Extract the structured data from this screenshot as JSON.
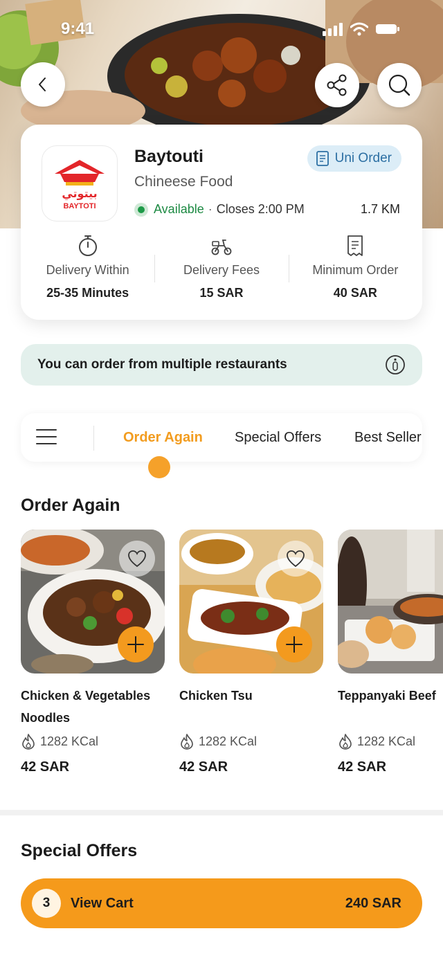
{
  "status_bar": {
    "time": "9:41"
  },
  "restaurant": {
    "name": "Baytouti",
    "cuisine": "Chineese Food",
    "logo_text_ar": "بيتوتي",
    "logo_text_en": "BAYTOTI",
    "uni_order_label": "Uni Order",
    "availability": "Available",
    "closes": "Closes 2:00 PM",
    "distance": "1.7 KM",
    "stats": [
      {
        "icon": "timer-icon",
        "label": "Delivery Within",
        "value": "25-35 Minutes"
      },
      {
        "icon": "scooter-icon",
        "label": "Delivery Fees",
        "value": "15 SAR"
      },
      {
        "icon": "receipt-icon",
        "label": "Minimum Order",
        "value": "40 SAR"
      }
    ]
  },
  "banner": {
    "text": "You can order from multiple restaurants",
    "icon": "info-icon"
  },
  "tabs": [
    {
      "label": "Order Again",
      "active": true
    },
    {
      "label": "Special Offers",
      "active": false
    },
    {
      "label": "Best Seller",
      "active": false
    }
  ],
  "order_again": {
    "title": "Order Again",
    "items": [
      {
        "name": "Chicken & Vegetables Noodles",
        "kcal": "1282 KCal",
        "price": "42 SAR"
      },
      {
        "name": "Chicken Tsu",
        "kcal": "1282 KCal",
        "price": "42 SAR"
      },
      {
        "name": "Teppanyaki Beef",
        "kcal": "1282 KCal",
        "price": "42 SAR"
      }
    ]
  },
  "special_offers": {
    "title": "Special Offers"
  },
  "cart": {
    "count": "3",
    "label": "View Cart",
    "total": "240 SAR"
  },
  "colors": {
    "accent": "#f59a1b",
    "available": "#1d9a48",
    "uni_order_bg": "#dcedf7",
    "banner_bg": "#e3f0ec"
  }
}
